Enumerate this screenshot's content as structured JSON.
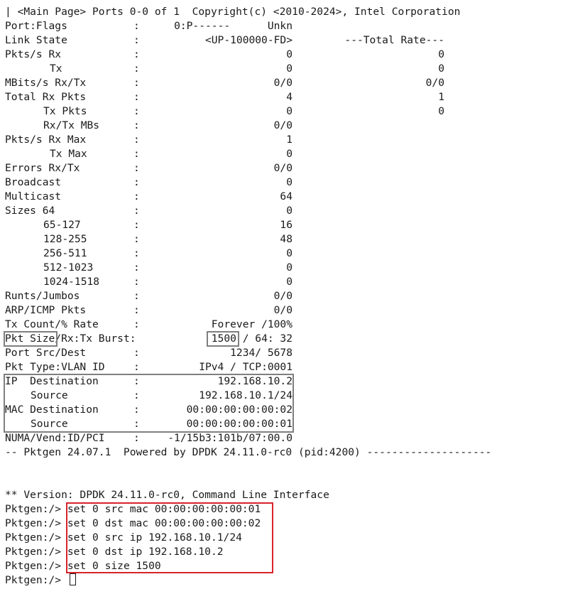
{
  "header": {
    "main_page": "| <Main Page> Ports 0-0 of 1  Copyright(c) <2010-2024>, Intel Corporation"
  },
  "stats": [
    {
      "label": "Port:Flags",
      "value": "0:P------      Unkn",
      "total": ""
    },
    {
      "label": "Link State",
      "value": "<UP-100000-FD>",
      "total": "---Total Rate---"
    },
    {
      "label": "Pkts/s Rx",
      "value": "0",
      "total": "0"
    },
    {
      "label": "Tx",
      "value": "0",
      "total": "0"
    },
    {
      "label": "MBits/s Rx/Tx",
      "value": "0/0",
      "total": "0/0"
    },
    {
      "label": "Total Rx Pkts",
      "value": "4",
      "total": "1"
    },
    {
      "label": "Tx Pkts",
      "value": "0",
      "total": "0"
    },
    {
      "label": "Rx/Tx MBs",
      "value": "0/0",
      "total": ""
    },
    {
      "label": "Pkts/s Rx Max",
      "value": "1",
      "total": ""
    },
    {
      "label": "Tx Max",
      "value": "0",
      "total": ""
    },
    {
      "label": "Errors Rx/Tx",
      "value": "0/0",
      "total": ""
    },
    {
      "label": "Broadcast",
      "value": "0",
      "total": ""
    },
    {
      "label": "Multicast",
      "value": "64",
      "total": ""
    },
    {
      "label": "Sizes 64",
      "value": "0",
      "total": ""
    },
    {
      "label": "65-127",
      "value": "16",
      "total": ""
    },
    {
      "label": "128-255",
      "value": "48",
      "total": ""
    },
    {
      "label": "256-511",
      "value": "0",
      "total": ""
    },
    {
      "label": "512-1023",
      "value": "0",
      "total": ""
    },
    {
      "label": "1024-1518",
      "value": "0",
      "total": ""
    },
    {
      "label": "Runts/Jumbos",
      "value": "0/0",
      "total": ""
    },
    {
      "label": "ARP/ICMP Pkts",
      "value": "0/0",
      "total": ""
    },
    {
      "label": "Tx Count/% Rate",
      "value": "Forever /100%",
      "total": ""
    },
    {
      "label": "Pkt Size/Rx:Tx Burst:",
      "value": "1500 / 64: 32",
      "total": ""
    },
    {
      "label": "Port Src/Dest",
      "value": "1234/ 5678",
      "total": ""
    },
    {
      "label": "Pkt Type:VLAN ID",
      "value": "IPv4 / TCP:0001",
      "total": ""
    },
    {
      "label": "IP  Destination",
      "value": "192.168.10.2",
      "total": ""
    },
    {
      "label": "Source",
      "value": "192.168.10.1/24",
      "total": ""
    },
    {
      "label": "MAC Destination",
      "value": "00:00:00:00:00:02",
      "total": ""
    },
    {
      "label": "Source",
      "value": "00:00:00:00:00:01",
      "total": ""
    },
    {
      "label": "NUMA/Vend:ID/PCI",
      "value": "-1/15b3:101b/07:00.0",
      "total": ""
    }
  ],
  "pkt_size_label": "Pkt Size",
  "burst_label": "/Rx:Tx Burst:",
  "pkt_size_value": "1500",
  "burst_value": " / 64: 32",
  "footer": "-- Pktgen 24.07.1  Powered by DPDK 24.11.0-rc0 (pid:4200) --------------------",
  "cli": {
    "version": "** Version: DPDK 24.11.0-rc0, Command Line Interface",
    "prompt": "Pktgen:/> ",
    "commands": [
      "set 0 src mac 00:00:00:00:00:01",
      "set 0 dst mac 00:00:00:00:00:02",
      "set 0 src ip 192.168.10.1/24",
      "set 0 dst ip 192.168.10.2",
      "set 0 size 1500"
    ]
  },
  "colors": {
    "highlight_gray": "#7f7f7f",
    "highlight_red": "#d8232a"
  }
}
